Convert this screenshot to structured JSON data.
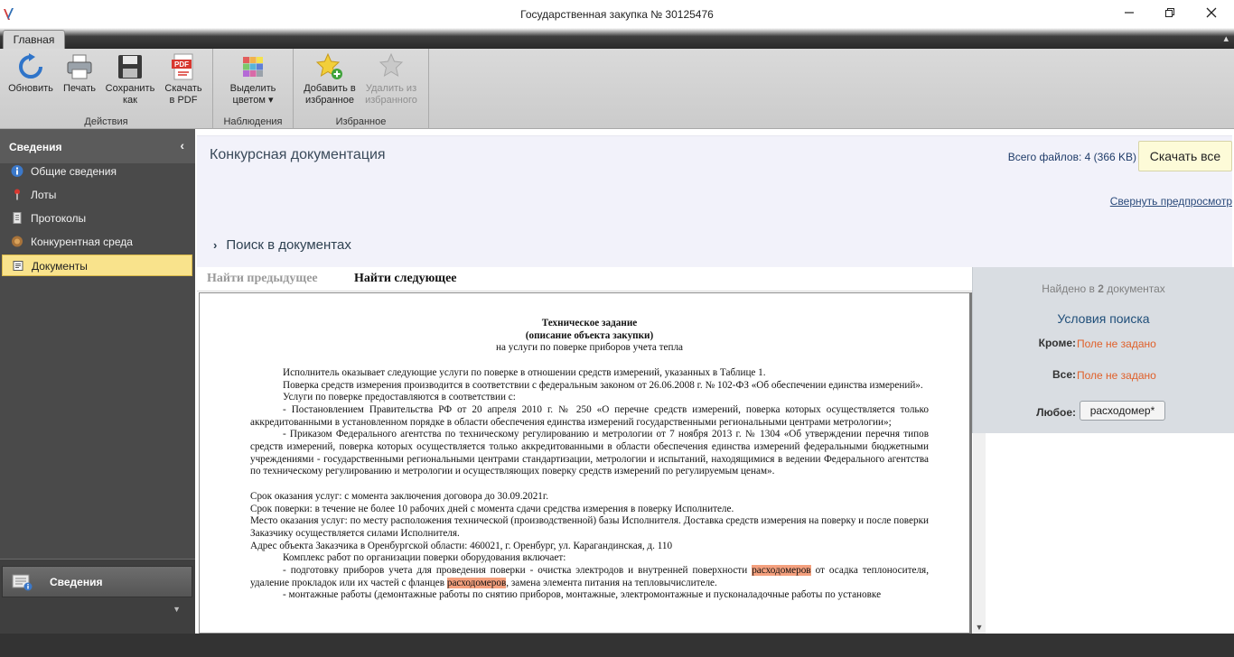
{
  "window": {
    "title": "Государственная закупка № 30125476",
    "minimize": "🗕",
    "restore": "🗗",
    "close": "✕"
  },
  "ribbon": {
    "tab": "Главная",
    "groups": [
      {
        "label": "Действия"
      },
      {
        "label": "Наблюдения"
      },
      {
        "label": "Избранное"
      }
    ],
    "buttons": {
      "refresh": {
        "line1": "Обновить",
        "line2": ""
      },
      "print": {
        "line1": "Печать",
        "line2": ""
      },
      "save_as": {
        "line1": "Сохранить",
        "line2": "как"
      },
      "download_pdf": {
        "line1": "Скачать",
        "line2": "в PDF"
      },
      "highlight": {
        "line1": "Выделить",
        "line2": "цветом ▾"
      },
      "add_fav": {
        "line1": "Добавить в",
        "line2": "избранное"
      },
      "remove_fav": {
        "line1": "Удалить из",
        "line2": "избранного"
      }
    }
  },
  "sidebar": {
    "header": "Сведения",
    "items": [
      {
        "label": "Общие сведения",
        "icon": "info-icon"
      },
      {
        "label": "Лоты",
        "icon": "pin-icon"
      },
      {
        "label": "Протоколы",
        "icon": "document-icon"
      },
      {
        "label": "Конкурентная среда",
        "icon": "competition-icon"
      },
      {
        "label": "Документы",
        "icon": "documents-icon"
      }
    ],
    "bottom_button": "Сведения"
  },
  "main": {
    "title": "Конкурсная документация",
    "files_total": "Всего файлов: 4 (366 KB)",
    "download_all": "Скачать все",
    "collapse_preview": "Свернуть предпросмотр",
    "search_section": "Поиск в документах",
    "find_prev": "Найти предыдущее",
    "find_next": "Найти следующее"
  },
  "document": {
    "title1": "Техническое задание",
    "title2": "(описание объекта закупки)",
    "title3": "на услуги по поверке приборов учета тепла",
    "p1": "Исполнитель оказывает следующие услуги по поверке в отношении средств измерений, указанных в Таблице 1.",
    "p2": "Поверка средств измерения производится в соответствии с федеральным законом от 26.06.2008 г. № 102-ФЗ «Об обеспечении единства измерений».",
    "p3": "Услуги по поверке предоставляются в соответствии с:",
    "p4": "- Постановлением Правительства РФ от 20 апреля 2010 г. № 250 «О перечне средств измерений, поверка которых осуществляется только аккредитованными в установленном порядке в области обеспечения единства измерений государственными региональными центрами метрологии»;",
    "p5": "- Приказом Федерального агентства по техническому регулированию и метрологии от 7 ноября 2013 г. № 1304 «Об утверждении перечня типов средств измерений, поверка которых осуществляется только аккредитованными в области обеспечения единства измерений федеральными бюджетными учреждениями - государственными региональными центрами стандартизации, метрологии и испытаний, находящимися в ведении Федерального агентства по техническому регулированию и метрологии и осуществляющих поверку средств измерений по регулируемым ценам».",
    "p6": "Срок оказания услуг: с момента заключения договора до 30.09.2021г.",
    "p7": "Срок поверки: в течение не более 10 рабочих дней с момента сдачи средства измерения в поверку Исполнителе.",
    "p8": "Место оказания услуг: по месту расположения технической (производственной) базы Исполнителя. Доставка средств измерения на поверку и после поверки Заказчику осуществляется силами Исполнителя.",
    "p9": "Адрес объекта Заказчика в Оренбургской области: 460021, г. Оренбург, ул. Карагандинская, д. 110",
    "p10": "Комплекс работ по организации поверки оборудования включает:",
    "p11a": "- подготовку приборов учета для проведения поверки - очистка электродов и внутренней поверхности ",
    "hl1": "расходомеров",
    "p11b": " от осадка теплоносителя, удаление прокладок или их частей с фланцев ",
    "hl2": "расходомеров",
    "p11c": ", замена элемента питания на тепловычислителе.",
    "p12": "- монтажные работы (демонтажные работы по снятию приборов, монтажные, электромонтажные и пусконаладочные работы по установке"
  },
  "search_panel": {
    "found_prefix": "Найдено в ",
    "found_count": "2",
    "found_suffix": " документах",
    "conditions_title": "Условия поиска",
    "except_label": "Кроме:",
    "except_value": "Поле не задано",
    "all_label": "Все:",
    "all_value": "Поле не задано",
    "any_label": "Любое:",
    "any_value": "расходомер*"
  },
  "colors": {
    "highlight": "#f4a07e",
    "active_item": "#f9e38c",
    "not_set": "#e0602a"
  }
}
